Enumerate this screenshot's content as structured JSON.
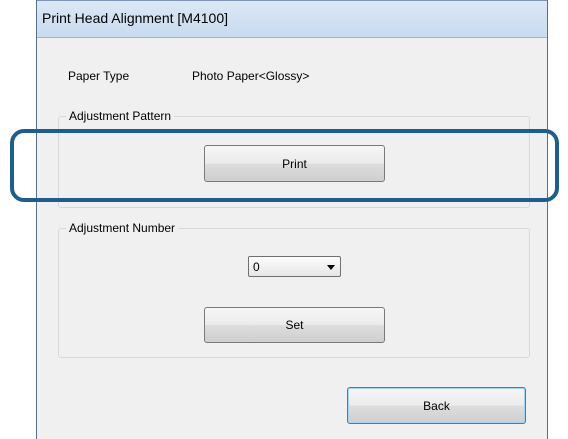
{
  "window": {
    "title": "Print Head Alignment [M4100]"
  },
  "paper_type": {
    "label": "Paper Type",
    "value": "Photo Paper<Glossy>"
  },
  "adjustment_pattern": {
    "group_label": "Adjustment Pattern",
    "print_button": "Print"
  },
  "adjustment_number": {
    "group_label": "Adjustment Number",
    "selected_value": "0",
    "set_button": "Set"
  },
  "footer": {
    "back_button": "Back"
  },
  "colors": {
    "highlight_frame": "#1f5e8c",
    "dialog_background": "#f0f0f0"
  }
}
